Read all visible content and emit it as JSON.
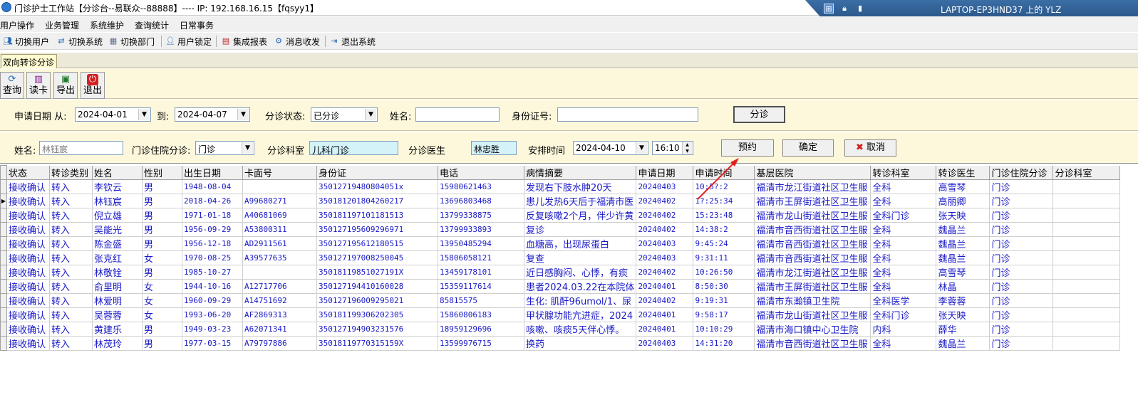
{
  "window": {
    "title": "门诊护士工作站【分诊台--易联众--88888】---- IP:  192.168.16.15【fqsyy1】"
  },
  "remote": {
    "title": "LAPTOP-EP3HND37 上的 YLZ"
  },
  "menubar": {
    "items": [
      "用户操作",
      "业务管理",
      "系统维护",
      "查询统计",
      "日常事务"
    ]
  },
  "toolbar": {
    "items": [
      "切换用户",
      "切换系统",
      "切换部门",
      "用户锁定",
      "集成报表",
      "消息收发",
      "退出系统"
    ]
  },
  "tab": {
    "label": "双向转诊分诊"
  },
  "bigbuttons": [
    "查询",
    "读卡",
    "导出",
    "退出"
  ],
  "filter": {
    "apply_date_label": "申请日期  从:",
    "from_date": "2024-04-01",
    "to_label": "到:",
    "to_date": "2024-04-07",
    "status_label": "分诊状态:",
    "status_value": "已分诊",
    "name_label": "姓名:",
    "name_value": "",
    "id_label": "身份证号:",
    "id_value": "",
    "triage_button": "分诊"
  },
  "assign": {
    "name_label": "姓名:",
    "name_value": "林钰宸",
    "type_label": "门诊住院分诊:",
    "type_value": "门诊",
    "dept_label": "分诊科室",
    "dept_value": "儿科门诊",
    "doctor_label": "分诊医生",
    "doctor_value": "林忠胜",
    "time_label": "安排时间",
    "date_value": "2024-04-10",
    "time_value": "16:10",
    "book_button": "预约",
    "confirm_button": "确定",
    "cancel_button": "取消"
  },
  "table": {
    "columns": [
      "状态",
      "转诊类别",
      "姓名",
      "性别",
      "出生日期",
      "卡面号",
      "身份证",
      "电话",
      "病情摘要",
      "申请日期",
      "申请时间",
      "基层医院",
      "转诊科室",
      "转诊医生",
      "门诊住院分诊",
      "分诊科室"
    ],
    "rows": [
      [
        "接收确认",
        "转入",
        "李钦云",
        "男",
        "1948-08-04",
        "",
        "35012719480804051x",
        "15980621463",
        "发现右下肢水肿20天",
        "20240403",
        "10:5?:2",
        "福清市龙江街道社区卫生服",
        "全科",
        "高雪琴",
        "门诊",
        ""
      ],
      [
        "接收确认",
        "转入",
        "林钰宸",
        "男",
        "2018-04-26",
        "A99680271",
        "350181201804260217",
        "13696803468",
        "患儿发热6天后于福清市医",
        "20240402",
        "1?:25:34",
        "福清市王屏街道社区卫生服",
        "全科",
        "高丽卿",
        "门诊",
        ""
      ],
      [
        "接收确认",
        "转入",
        "倪立雄",
        "男",
        "1971-01-18",
        "A40681069",
        "350181197101181513",
        "13799338875",
        "反复咳嗽2个月，伴少许黄",
        "20240402",
        "15:23:48",
        "福清市龙山街道社区卫生服",
        "全科门诊",
        "张天映",
        "门诊",
        ""
      ],
      [
        "接收确认",
        "转入",
        "吴能光",
        "男",
        "1956-09-29",
        "A53800311",
        "350127195609296971",
        "13799933893",
        "复诊",
        "20240402",
        "14:38:2",
        "福清市音西街道社区卫生服",
        "全科",
        "魏晶兰",
        "门诊",
        ""
      ],
      [
        "接收确认",
        "转入",
        "陈金盛",
        "男",
        "1956-12-18",
        "AD2911561",
        "350127195612180515",
        "13950485294",
        "血糖高，出现尿蛋白",
        "20240403",
        "9:45:24",
        "福清市音西街道社区卫生服",
        "全科",
        "魏晶兰",
        "门诊",
        ""
      ],
      [
        "接收确认",
        "转入",
        "张克红",
        "女",
        "1970-08-25",
        "A39577635",
        "350127197008250045",
        "15806058121",
        "复查",
        "20240403",
        "9:31:11",
        "福清市音西街道社区卫生服",
        "全科",
        "魏晶兰",
        "门诊",
        ""
      ],
      [
        "接收确认",
        "转入",
        "林敬铨",
        "男",
        "1985-10-27",
        "",
        "35018119851027191X",
        "13459178101",
        "近日感胸闷、心悸，有痰",
        "20240402",
        "10:26:50",
        "福清市龙江街道社区卫生服",
        "全科",
        "高雪琴",
        "门诊",
        ""
      ],
      [
        "接收确认",
        "转入",
        "俞里明",
        "女",
        "1944-10-16",
        "A12717706",
        "350127194410160028",
        "15359117614",
        "患者2024.03.22在本院体",
        "20240401",
        "8:50:30",
        "福清市王屏街道社区卫生服",
        "全科",
        "林晶",
        "门诊",
        ""
      ],
      [
        "接收确认",
        "转入",
        "林爱明",
        "女",
        "1960-09-29",
        "A14751692",
        "350127196009295021",
        "85815575",
        "生化: 肌酐96umol/1、尿",
        "20240402",
        "9:19:31",
        "福清市东瀚镇卫生院",
        "全科医学",
        "李蓉蓉",
        "门诊",
        ""
      ],
      [
        "接收确认",
        "转入",
        "吴蓉蓉",
        "女",
        "1993-06-20",
        "AF2869313",
        "350181199306202305",
        "15860806183",
        "甲状腺功能亢进症，2024",
        "20240401",
        "9:58:17",
        "福清市龙山街道社区卫生服",
        "全科门诊",
        "张天映",
        "门诊",
        ""
      ],
      [
        "接收确认",
        "转入",
        "黄建乐",
        "男",
        "1949-03-23",
        "A62071341",
        "350127194903231576",
        "18959129696",
        "咳嗽、咳痰5天伴心悸。",
        "20240401",
        "10:10:29",
        "福清市海口镇中心卫生院",
        "内科",
        "薛华",
        "门诊",
        ""
      ],
      [
        "接收确认",
        "转入",
        "林茂玲",
        "男",
        "1977-03-15",
        "A79797886",
        "35018119770315159X",
        "13599976715",
        "换药",
        "20240403",
        "14:31:20",
        "福清市音西街道社区卫生服",
        "全科",
        "魏晶兰",
        "门诊",
        ""
      ]
    ],
    "current_row": 1
  },
  "colors": {
    "accent_blue": "#1a1ac8",
    "panel_yellow": "#fdf8dc",
    "cyan_field": "#d4f3f8",
    "arrow_red": "#e02020"
  }
}
